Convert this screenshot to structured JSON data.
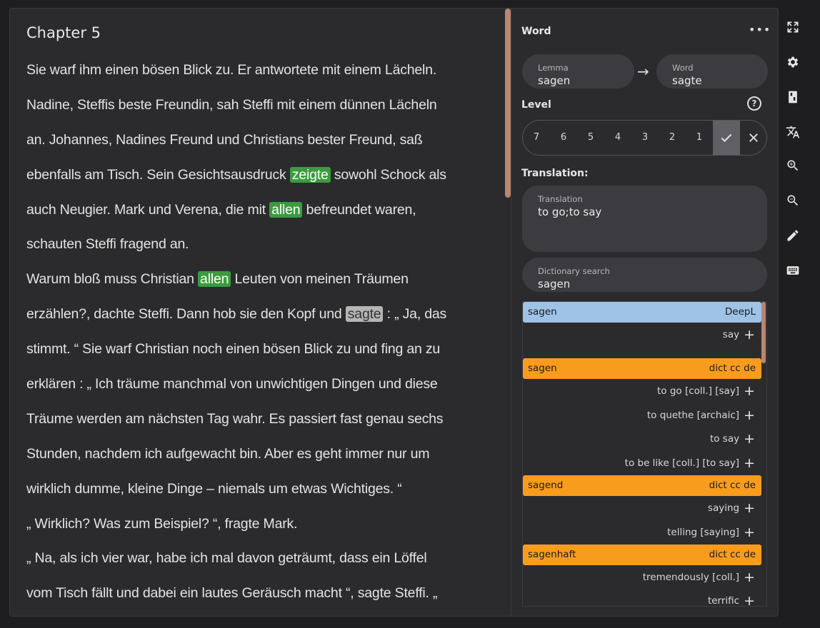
{
  "reader": {
    "chapter_title": "Chapter 5",
    "lines": [
      [
        {
          "t": "Sie warf ihm einen bösen Blick zu. Er antwortete mit einem Lächeln."
        }
      ],
      [
        {
          "t": "Nadine, Steffis beste Freundin, sah Steffi mit einem dünnen Lächeln"
        }
      ],
      [
        {
          "t": "an. Johannes, Nadines Freund und Christians bester Freund, saß"
        }
      ],
      [
        {
          "t": "ebenfalls am Tisch. Sein Gesichtsausdruck "
        },
        {
          "t": "zeigte",
          "h": "green"
        },
        {
          "t": " sowohl Schock als"
        }
      ],
      [
        {
          "t": "auch Neugier. Mark und Verena, die mit "
        },
        {
          "t": "allen",
          "h": "green"
        },
        {
          "t": " befreundet waren,"
        }
      ],
      [
        {
          "t": "schauten Steffi fragend an."
        }
      ],
      [
        {
          "t": "Warum bloß muss Christian "
        },
        {
          "t": "allen",
          "h": "green"
        },
        {
          "t": " Leuten von meinen Träumen"
        }
      ],
      [
        {
          "t": "erzählen?, dachte Steffi. Dann hob sie den Kopf und "
        },
        {
          "t": "sagte",
          "h": "grey"
        },
        {
          "t": " : „ Ja, das"
        }
      ],
      [
        {
          "t": "stimmt. “ Sie warf Christian noch einen bösen Blick zu und fing an zu"
        }
      ],
      [
        {
          "t": "erklären : „ Ich träume manchmal von unwichtigen Dingen und diese"
        }
      ],
      [
        {
          "t": "Träume werden am nächsten Tag wahr. Es passiert fast genau sechs"
        }
      ],
      [
        {
          "t": "Stunden, nachdem ich aufgewacht bin. Aber es geht immer nur um"
        }
      ],
      [
        {
          "t": "wirklich dumme, kleine Dinge – niemals um etwas Wichtiges. “"
        }
      ],
      [
        {
          "t": "„ Wirklich? Was zum Beispiel? “, fragte Mark."
        }
      ],
      [
        {
          "t": "„ Na, als ich vier war, habe ich mal davon geträumt, dass ein Löffel"
        }
      ],
      [
        {
          "t": "vom Tisch fällt und dabei ein lautes Geräusch macht “, sagte Steffi. „"
        }
      ]
    ]
  },
  "panel": {
    "title": "Word",
    "more_icon": "more-horizontal-icon",
    "lemma": {
      "label": "Lemma",
      "value": "sagen"
    },
    "word": {
      "label": "Word",
      "value": "sagte"
    },
    "level_label": "Level",
    "levels": [
      "7",
      "6",
      "5",
      "4",
      "3",
      "2",
      "1"
    ],
    "level_selected": "check",
    "translation_label": "Translation:",
    "translation": {
      "label": "Translation",
      "value": "to go;to say"
    },
    "dictionary_search": {
      "label": "Dictionary search",
      "value": "sagen"
    },
    "dictionary": [
      {
        "word": "sagen",
        "source": "DeepL",
        "color": "#9fc3e6",
        "entries": [
          "say"
        ]
      },
      {
        "word": "sagen",
        "source": "dict cc de",
        "color": "#f89c1e",
        "entries": [
          "to go [coll.] [say]",
          "to quethe [archaic]",
          "to say",
          "to be like [coll.] [to say]"
        ]
      },
      {
        "word": "sagend",
        "source": "dict cc de",
        "color": "#f89c1e",
        "entries": [
          "saying",
          "telling [saying]"
        ]
      },
      {
        "word": "sagenhaft",
        "source": "dict cc de",
        "color": "#f89c1e",
        "entries": [
          "tremendously [coll.]",
          "terrific"
        ]
      }
    ]
  },
  "toolbar": [
    "fullscreen-icon",
    "settings-icon",
    "dictionary-icon",
    "translate-icon",
    "zoom-in-icon",
    "zoom-out-icon",
    "highlighter-icon",
    "keyboard-icon"
  ]
}
